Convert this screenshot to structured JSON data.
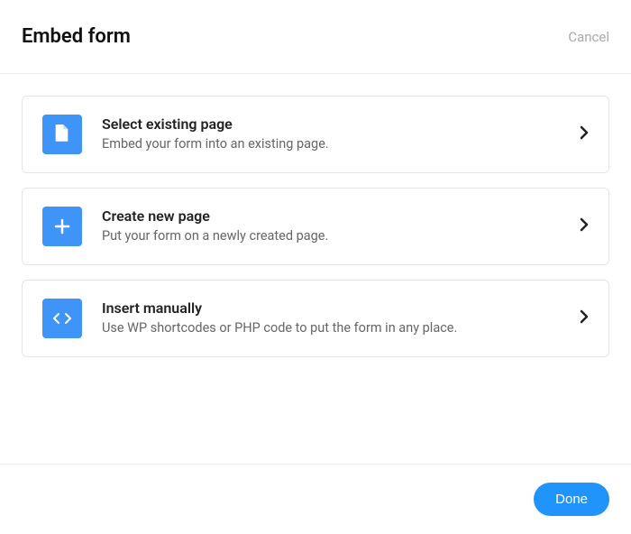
{
  "header": {
    "title": "Embed form",
    "cancel_label": "Cancel"
  },
  "options": [
    {
      "icon": "page-icon",
      "title": "Select existing page",
      "description": "Embed your form into an existing page."
    },
    {
      "icon": "plus-icon",
      "title": "Create new page",
      "description": "Put your form on a newly created page."
    },
    {
      "icon": "code-icon",
      "title": "Insert manually",
      "description": "Use WP shortcodes or PHP code to put the form in any place."
    }
  ],
  "footer": {
    "done_label": "Done"
  },
  "colors": {
    "accent": "#3F94F7",
    "done_button": "#2094FA"
  }
}
